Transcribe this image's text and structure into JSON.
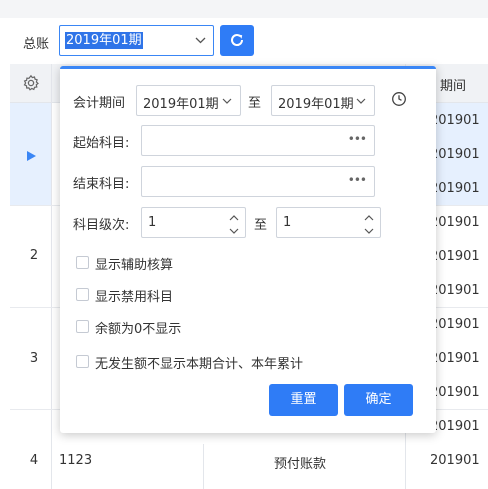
{
  "header": {
    "label": "总账",
    "period_value": "2019年01期",
    "refresh_icon": "refresh-icon"
  },
  "table": {
    "period_header": "期间",
    "rows": [
      {
        "num": "",
        "code": "",
        "name": "",
        "periods": [
          "201901",
          "201901",
          "201901"
        ]
      },
      {
        "num": "2",
        "code": "",
        "name": "",
        "periods": [
          "201901",
          "201901",
          "201901"
        ]
      },
      {
        "num": "3",
        "code": "",
        "name": "",
        "periods": [
          "201901",
          "201901",
          "201901"
        ]
      },
      {
        "num": "4",
        "code": "1123",
        "name": "预付账款",
        "periods": [
          "201901",
          "201901"
        ]
      }
    ]
  },
  "popup": {
    "period_label": "会计期间",
    "period_from": "2019年01期",
    "to_label": "至",
    "period_to": "2019年01期",
    "start_account_label": "起始科目:",
    "start_account_value": "",
    "end_account_label": "结束科目:",
    "end_account_value": "",
    "level_label": "科目级次:",
    "level_from": "1",
    "level_to_label": "至",
    "level_to": "1",
    "checkboxes": [
      {
        "label": "显示辅助核算",
        "checked": false
      },
      {
        "label": "显示禁用科目",
        "checked": false
      },
      {
        "label": "余额为0不显示",
        "checked": false
      },
      {
        "label": "无发生额不显示本期合计、本年累计",
        "checked": false
      }
    ],
    "reset_label": "重置",
    "confirm_label": "确定"
  },
  "colors": {
    "accent": "#2f7cf6",
    "selection_bg": "#e6f0fe"
  }
}
